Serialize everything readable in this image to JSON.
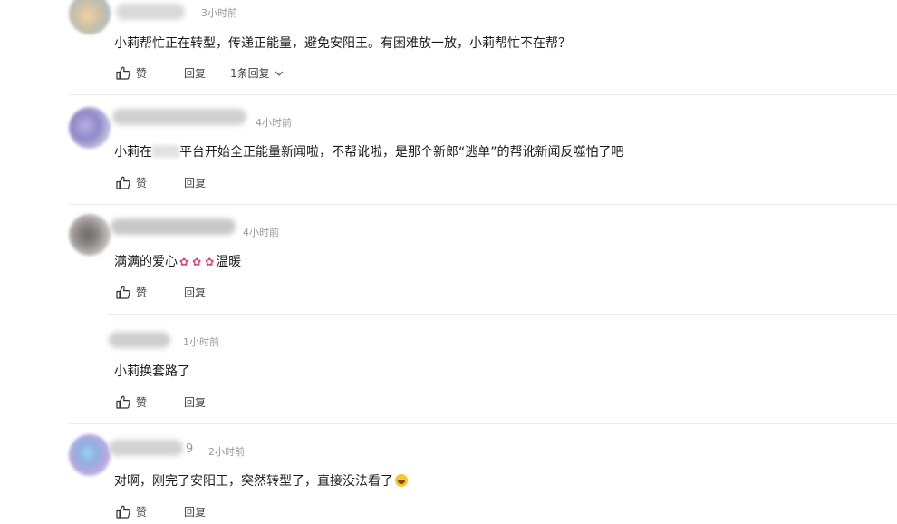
{
  "comments": [
    {
      "time": "3小时前",
      "text": "小莉帮忙正在转型，传递正能量，避免安阳王。有困难放一放，小莉帮忙不在帮？",
      "like_label": "赞",
      "reply_label": "回复",
      "reply_count_label": "1条回复"
    },
    {
      "time": "4小时前",
      "text_a": "小莉在",
      "text_b": "平台开始全正能量新闻啦，不帮讹啦，是那个新郎“逃单”的帮讹新闻反噬怕了吧",
      "like_label": "赞",
      "reply_label": "回复"
    },
    {
      "time": "4小时前",
      "text_a": "满满的爱心",
      "text_b": "温暖",
      "rose_icon": "rose-emoji",
      "like_label": "赞",
      "reply_label": "回复"
    },
    {
      "time": "1小时前",
      "text": "小莉换套路了",
      "like_label": "赞",
      "reply_label": "回复"
    },
    {
      "name_tail": "9",
      "time": "2小时前",
      "text": "对啊，刚完了安阳王，突然转型了，直接没法看了",
      "emoji_icon": "laugh-cry-emoji",
      "like_label": "赞",
      "reply_label": "回复"
    }
  ],
  "colors": {
    "text": "#1a1a1a",
    "meta": "#999999",
    "divider": "#ececec"
  },
  "icons": {
    "like": "thumbs-up-icon",
    "expand": "chevron-down-icon"
  }
}
